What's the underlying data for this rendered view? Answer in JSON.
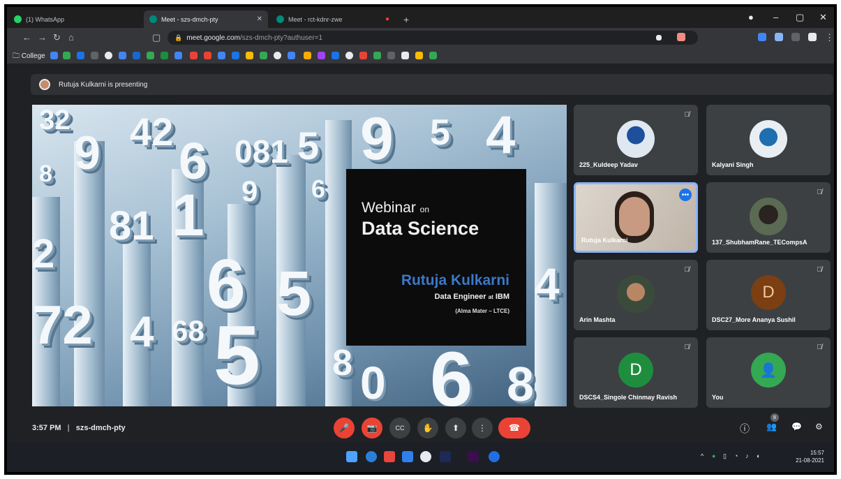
{
  "browser": {
    "tabs": [
      {
        "label": "(1) WhatsApp",
        "favicon_color": "#25d366",
        "active": false
      },
      {
        "label": "Meet - szs-dmch-pty",
        "favicon_color": "#00897b",
        "active": true
      },
      {
        "label": "Meet - rct-kdnr-zwe",
        "favicon_color": "#00897b",
        "active": false
      }
    ],
    "new_tab": "+",
    "url_domain": "meet.google.com",
    "url_path": "/szs-dmch-pty?authuser=1",
    "bookmarks_folder": "College"
  },
  "meet": {
    "presenting_banner": "Rutuja Kulkarni is presenting",
    "slide": {
      "title_word": "Webinar",
      "title_on": "on",
      "title_topic": "Data Science",
      "presenter_name": "Rutuja Kulkarni",
      "role_prefix": "Data Engineer",
      "role_at": "at",
      "role_company": "IBM",
      "alma_mater": "(Alma Mater – LTCE)"
    },
    "participants": [
      {
        "name": "225_Kuldeep Yadav",
        "muted": true
      },
      {
        "name": "Kalyani Singh",
        "muted": false
      },
      {
        "name": "Rutuja Kulkarni",
        "muted": false
      },
      {
        "name": "137_ShubhamRane_TECompsA",
        "muted": true
      },
      {
        "name": "Arin Mashta",
        "muted": true
      },
      {
        "name": "DSC27_More Ananya Sushil",
        "muted": true,
        "initial": "D",
        "avatar_color": "#7b3f12",
        "initial_color": "#f2c6a0"
      },
      {
        "name": "DSCS4_Singole Chinmay Ravish",
        "muted": true,
        "initial": "D",
        "avatar_color": "#1e8e3e",
        "initial_color": "#ffffff"
      },
      {
        "name": "You",
        "muted": true
      }
    ],
    "time": "3:57 PM",
    "separator": "|",
    "meeting_code": "szs-dmch-pty",
    "people_count": "8"
  },
  "taskbar": {
    "time": "15:57",
    "date": "21-08-2021"
  },
  "icons": {
    "mic_off": "🎤",
    "cam_off": "📷",
    "captions": "CC",
    "raise_hand": "✋",
    "present": "⬆",
    "more": "⋮",
    "leave": "☎",
    "info": "ⓘ",
    "people": "👥",
    "chat": "💬",
    "activities": "⚙"
  }
}
